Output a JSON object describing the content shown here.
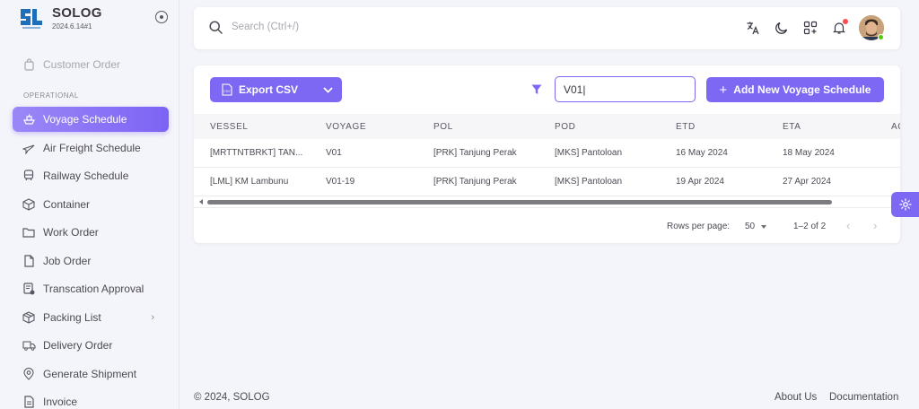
{
  "brand": {
    "name": "SOLOG",
    "version": "2024.6.14#1"
  },
  "sidebar": {
    "top_item": {
      "label": "Customer Order"
    },
    "section_label": "OPERATIONAL",
    "items": [
      {
        "label": "Voyage Schedule",
        "icon": "ship-icon",
        "active": true
      },
      {
        "label": "Air Freight Schedule",
        "icon": "plane-icon"
      },
      {
        "label": "Railway Schedule",
        "icon": "train-icon"
      },
      {
        "label": "Container",
        "icon": "box-icon"
      },
      {
        "label": "Work Order",
        "icon": "folder-icon"
      },
      {
        "label": "Job Order",
        "icon": "file-icon"
      },
      {
        "label": "Transcation Approval",
        "icon": "approval-icon"
      },
      {
        "label": "Packing List",
        "icon": "package-icon",
        "has_submenu": true
      },
      {
        "label": "Delivery Order",
        "icon": "truck-icon"
      },
      {
        "label": "Generate Shipment",
        "icon": "location-icon"
      },
      {
        "label": "Invoice",
        "icon": "invoice-icon"
      }
    ]
  },
  "search": {
    "placeholder": "Search (Ctrl+/)"
  },
  "toolbar": {
    "export_label": "Export CSV",
    "add_label": "Add New Voyage Schedule",
    "filter_value": "V01|"
  },
  "table": {
    "columns": [
      "VESSEL",
      "VOYAGE",
      "POL",
      "POD",
      "ETD",
      "ETA",
      "AC"
    ],
    "rows": [
      [
        "[MRTTNTBRKT] TAN...",
        "V01",
        "[PRK] Tanjung Perak",
        "[MKS] Pantoloan",
        "16 May 2024",
        "18 May 2024"
      ],
      [
        "[LML] KM Lambunu",
        "V01-19",
        "[PRK] Tanjung Perak",
        "[MKS] Pantoloan",
        "19 Apr 2024",
        "27 Apr 2024"
      ]
    ]
  },
  "pagination": {
    "rows_per_page_label": "Rows per page:",
    "rows_per_page_value": "50",
    "range": "1–2 of 2"
  },
  "footer": {
    "copyright": "© 2024, SOLOG",
    "links": [
      "About Us",
      "Documentation"
    ]
  },
  "colors": {
    "primary": "#7c68f3",
    "background": "#f4f5fa"
  }
}
